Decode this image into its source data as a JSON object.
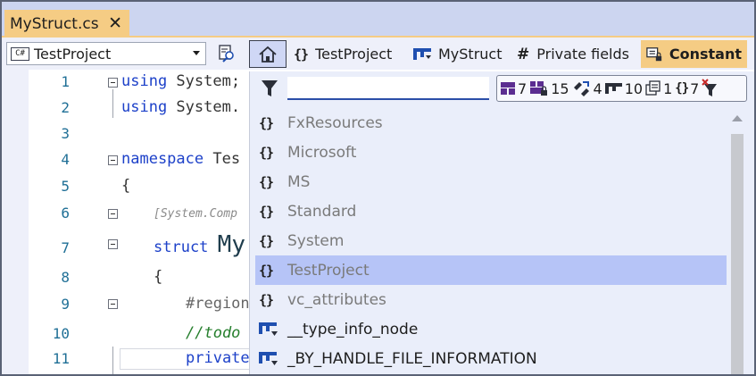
{
  "tab": {
    "title": "MyStruct.cs",
    "close": "✕"
  },
  "navbar": {
    "project": "TestProject",
    "project_icon": "C#",
    "crumbs": {
      "namespace": "TestProject",
      "struct": "MyStruct",
      "region": "Private fields",
      "constant": "Constant"
    }
  },
  "editor": {
    "line_numbers": [
      "1",
      "2",
      "3",
      "4",
      "5",
      "6",
      "7",
      "8",
      "9",
      "10",
      "11"
    ],
    "lines": {
      "l1_kw": "using",
      "l1_rest": " System;",
      "l2_kw": "using",
      "l2_rest": " System.",
      "l4_kw": "namespace",
      "l4_rest": " Tes",
      "l5": "{",
      "l6": "[System.Comp",
      "l7_kw": "struct",
      "l7_name": "My",
      "l8": "{",
      "l9": "#region",
      "l10": "//todo",
      "l11": "private"
    }
  },
  "popup": {
    "search": {
      "value": "",
      "placeholder": ""
    },
    "filters": {
      "classes": "7",
      "private_classes": "15",
      "enums": "4",
      "structs": "10",
      "typedefs": "1",
      "namespaces": "7"
    },
    "items": [
      {
        "label": "FxResources",
        "kind": "namespace",
        "icon": "namespace-icon"
      },
      {
        "label": "Microsoft",
        "kind": "namespace",
        "icon": "namespace-icon"
      },
      {
        "label": "MS",
        "kind": "namespace",
        "icon": "namespace-icon"
      },
      {
        "label": "Standard",
        "kind": "namespace",
        "icon": "namespace-icon"
      },
      {
        "label": "System",
        "kind": "namespace",
        "icon": "namespace-icon"
      },
      {
        "label": "TestProject",
        "kind": "namespace",
        "icon": "namespace-icon",
        "selected": true
      },
      {
        "label": "vc_attributes",
        "kind": "namespace",
        "icon": "namespace-icon"
      },
      {
        "label": "__type_info_node",
        "kind": "struct",
        "icon": "struct-icon"
      },
      {
        "label": "_BY_HANDLE_FILE_INFORMATION",
        "kind": "struct",
        "icon": "struct-icon"
      }
    ]
  },
  "colors": {
    "accent": "#f5cc84",
    "selection": "#b6c4f7",
    "keyword": "#1d41c9",
    "line_number": "#1f6f96",
    "struct_icon": "#1f4fb0"
  }
}
